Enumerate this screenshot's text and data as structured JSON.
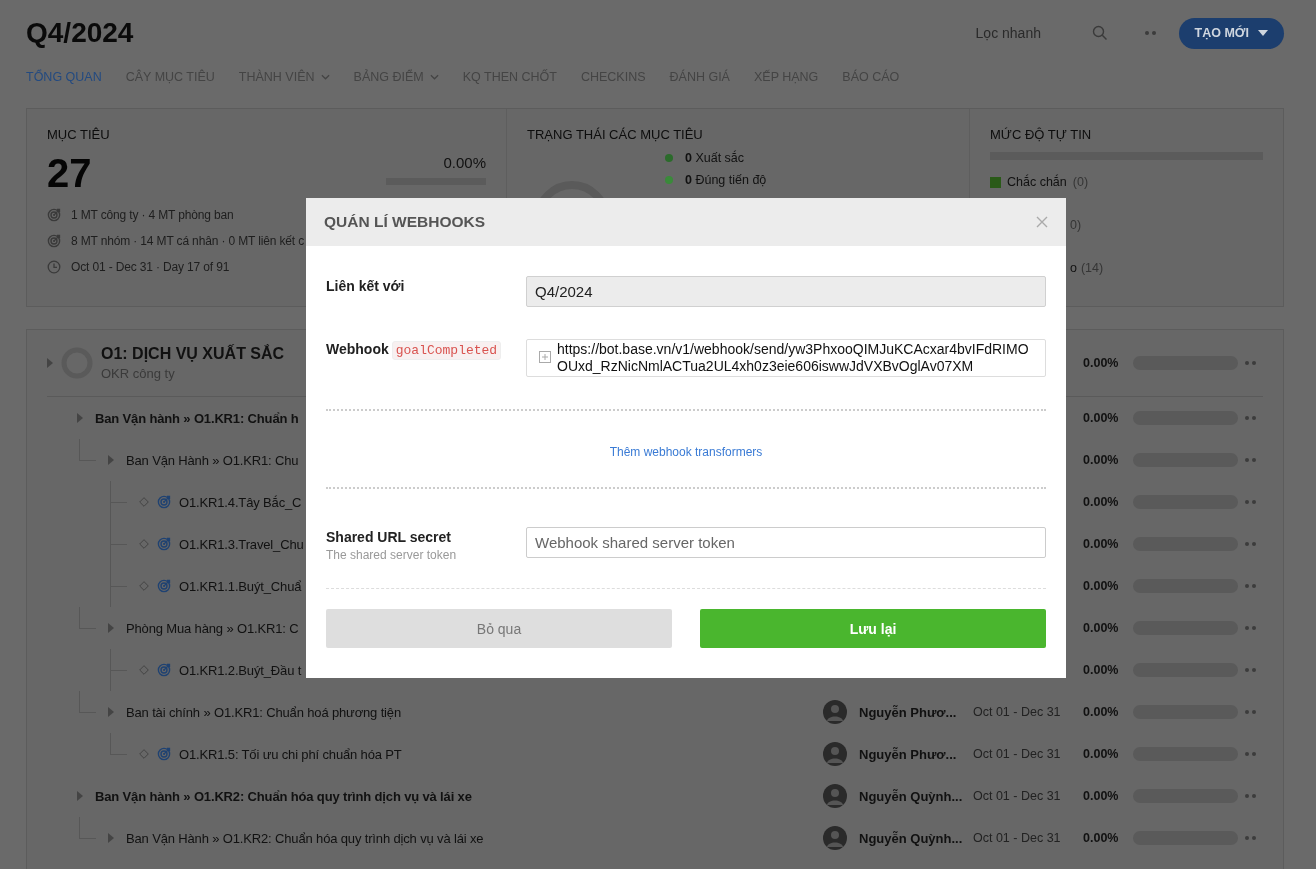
{
  "page": {
    "title": "Q4/2024"
  },
  "header": {
    "quick_filter": {
      "placeholder": "Lọc nhanh"
    },
    "create_button": "TẠO MỚI"
  },
  "tabs": [
    {
      "label": "TỔNG QUAN",
      "selected": true,
      "dropdown": false
    },
    {
      "label": "CÂY MỤC TIÊU",
      "selected": false,
      "dropdown": false
    },
    {
      "label": "THÀNH VIÊN",
      "selected": false,
      "dropdown": true
    },
    {
      "label": "BẢNG ĐIỂM",
      "selected": false,
      "dropdown": true
    },
    {
      "label": "KQ THEN CHỐT",
      "selected": false,
      "dropdown": false
    },
    {
      "label": "CHECKINS",
      "selected": false,
      "dropdown": false
    },
    {
      "label": "ĐÁNH GIÁ",
      "selected": false,
      "dropdown": false
    },
    {
      "label": "XẾP HẠNG",
      "selected": false,
      "dropdown": false
    },
    {
      "label": "BÁO CÁO",
      "selected": false,
      "dropdown": false
    }
  ],
  "summary": {
    "objectives": {
      "heading": "MỤC TIÊU",
      "count": "27",
      "percent": "0.00%",
      "level": 0,
      "stats": [
        {
          "kind": "target",
          "text": "1 MT công ty · 4 MT phòng ban"
        },
        {
          "kind": "target",
          "text": "8 MT nhóm · 14 MT cá nhân · 0 MT liên kết c"
        },
        {
          "kind": "clock",
          "text": "Oct 01 - Dec 31 · Day 17 of 91"
        }
      ]
    },
    "status": {
      "heading": "TRẠNG THÁI CÁC MỤC TIÊU",
      "legend": [
        {
          "count": "0",
          "label": "Xuất sắc",
          "color": "#2b6b2b"
        },
        {
          "count": "0",
          "label": "Đúng tiến độ",
          "color": "#3a8a3a"
        }
      ]
    },
    "confidence": {
      "heading": "MỨC ĐỘ TỰ TIN",
      "level": 0,
      "legend": [
        {
          "label": "Chắc chắn",
          "count": "(0)",
          "color": "#2a5a18"
        },
        {
          "count": "0)"
        },
        {
          "label": "o",
          "count": "(14)"
        }
      ]
    }
  },
  "objective": {
    "title": "O1: DỊCH VỤ XUẤT SẮC",
    "subtitle": "OKR công ty",
    "percent": "0.00%",
    "level": 0,
    "children": [
      {
        "kind": "group",
        "title": "Ban Vận hành » O1.KR1: Chuẩn h",
        "percent": "0.00%",
        "level": 0,
        "children": [
          {
            "kind": "group",
            "title": "Ban Vận Hành » O1.KR1: Chu",
            "percent": "0.00%",
            "level": 0,
            "children": [
              {
                "kind": "key_result",
                "title": "O1.KR1.4.Tây Bắc_C",
                "percent": "0.00%",
                "level": 0
              },
              {
                "kind": "key_result",
                "title": "O1.KR1.3.Travel_Chu",
                "percent": "0.00%",
                "level": 0
              },
              {
                "kind": "key_result",
                "title": "O1.KR1.1.Buýt_Chuẩ",
                "percent": "0.00%",
                "level": 0
              }
            ]
          },
          {
            "kind": "group",
            "title": "Phòng Mua hàng » O1.KR1: C",
            "percent": "0.00%",
            "level": 0,
            "children": [
              {
                "kind": "key_result",
                "title": "O1.KR1.2.Buýt_Đầu t",
                "percent": "0.00%",
                "level": 0
              }
            ]
          },
          {
            "kind": "group",
            "title": "Ban tài chính » O1.KR1: Chuẩn hoá phương tiện",
            "owner": "Nguyễn Phươ...",
            "dates": "Oct 01 - Dec 31",
            "percent": "0.00%",
            "level": 0,
            "children": [
              {
                "kind": "key_result",
                "title": "O1.KR1.5: Tối ưu chi phí chuẩn hóa PT",
                "owner": "Nguyễn Phươ...",
                "dates": "Oct 01 - Dec 31",
                "percent": "0.00%",
                "level": 0
              }
            ]
          }
        ]
      },
      {
        "kind": "group",
        "title": "Ban Vận hành » O1.KR2: Chuẩn hóa quy trình dịch vụ và lái xe",
        "owner": "Nguyễn Quỳnh...",
        "dates": "Oct 01 - Dec 31",
        "percent": "0.00%",
        "level": 0,
        "children": [
          {
            "kind": "group",
            "title": "Ban Vận Hành » O1.KR2: Chuẩn hóa quy trình dịch vụ và lái xe",
            "owner": "Nguyễn Quỳnh...",
            "dates": "Oct 01 - Dec 31",
            "percent": "0.00%",
            "level": 0
          }
        ]
      }
    ]
  },
  "modal": {
    "title": "QUÁN LÍ WEBHOOKS",
    "fields": [
      {
        "kind": "readonly",
        "label": "Liên kết với",
        "value": "Q4/2024"
      },
      {
        "kind": "url",
        "label": "Webhook",
        "tag": "goalCompleted",
        "value": "https://bot.base.vn/v1/webhook/send/yw3PhxooQIMJuKCAcxar4bvIFdRIMOOUxd_RzNicNmlACTua2UL4xh0z3eie606iswwJdVXBvOglAv07XM"
      },
      {
        "kind": "link",
        "text": "Thêm webhook transformers"
      },
      {
        "kind": "text",
        "label": "Shared URL secret",
        "hint": "The shared server token",
        "placeholder": "Webhook shared server token"
      }
    ],
    "buttons": [
      {
        "kind": "secondary",
        "label": "Bỏ qua"
      },
      {
        "kind": "primary",
        "label": "Lưu lại"
      }
    ]
  }
}
